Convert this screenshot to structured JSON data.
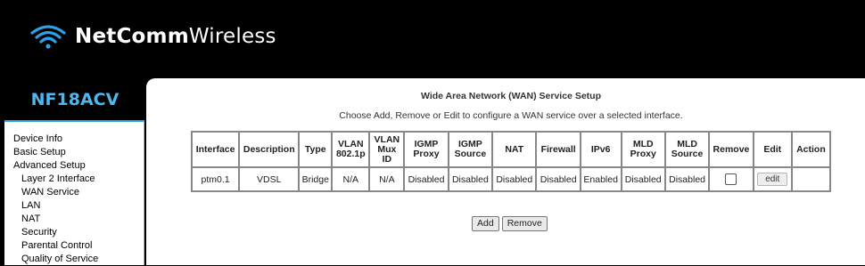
{
  "brand": {
    "name_bold": "NetComm",
    "name_light": "Wireless",
    "model": "NF18ACV"
  },
  "sidebar": {
    "items": [
      {
        "label": "Device Info",
        "sub": false
      },
      {
        "label": "Basic Setup",
        "sub": false
      },
      {
        "label": "Advanced Setup",
        "sub": false
      },
      {
        "label": "Layer 2 Interface",
        "sub": true
      },
      {
        "label": "WAN Service",
        "sub": true
      },
      {
        "label": "LAN",
        "sub": true
      },
      {
        "label": "NAT",
        "sub": true
      },
      {
        "label": "Security",
        "sub": true
      },
      {
        "label": "Parental Control",
        "sub": true
      },
      {
        "label": "Quality of Service",
        "sub": true
      }
    ]
  },
  "main": {
    "title": "Wide Area Network (WAN) Service Setup",
    "subtitle": "Choose Add, Remove or Edit to configure a WAN service over a selected interface.",
    "table": {
      "headers": {
        "interface": "Interface",
        "description": "Description",
        "type": "Type",
        "vlan_8021p": [
          "VLAN",
          "802.1p"
        ],
        "vlan_mux_id": [
          "VLAN",
          "Mux",
          "ID"
        ],
        "igmp_proxy": [
          "IGMP",
          "Proxy"
        ],
        "igmp_source": [
          "IGMP",
          "Source"
        ],
        "nat": "NAT",
        "firewall": "Firewall",
        "ipv6": "IPv6",
        "mld_proxy": [
          "MLD",
          "Proxy"
        ],
        "mld_source": [
          "MLD",
          "Source"
        ],
        "remove": "Remove",
        "edit": "Edit",
        "action": "Action"
      },
      "rows": [
        {
          "interface": "ptm0.1",
          "description": "VDSL",
          "type": "Bridge",
          "vlan_8021p": "N/A",
          "vlan_mux_id": "N/A",
          "igmp_proxy": "Disabled",
          "igmp_source": "Disabled",
          "nat": "Disabled",
          "firewall": "Disabled",
          "ipv6": "Enabled",
          "mld_proxy": "Disabled",
          "mld_source": "Disabled",
          "remove_checked": false,
          "edit_label": "edit",
          "action": ""
        }
      ]
    },
    "buttons": {
      "add": "Add",
      "remove": "Remove"
    }
  }
}
